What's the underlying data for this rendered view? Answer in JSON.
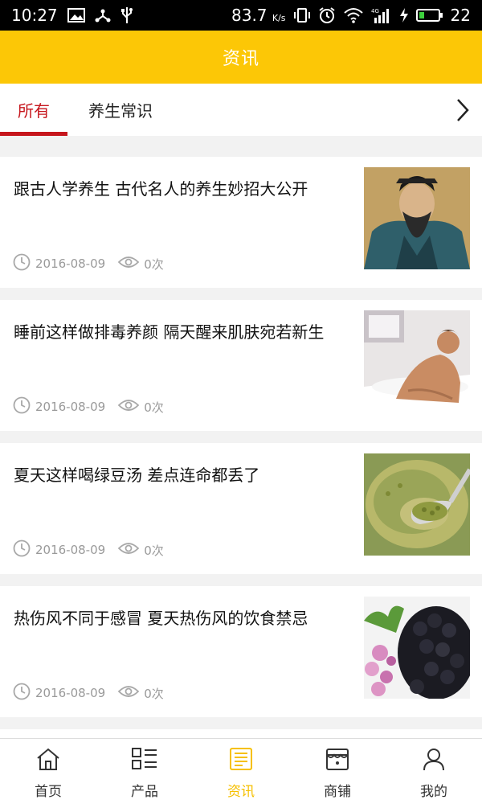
{
  "status_bar": {
    "time": "10:27",
    "speed": "83.7",
    "speed_unit": "K/s",
    "battery": "22",
    "network": "4G"
  },
  "header": {
    "title": "资讯"
  },
  "tabs": [
    {
      "label": "所有",
      "active": true
    },
    {
      "label": "养生常识",
      "active": false
    }
  ],
  "articles": [
    {
      "title": "跟古人学养生 古代名人的养生妙招大公开",
      "date": "2016-08-09",
      "views": "0次",
      "image": "ancient-portrait"
    },
    {
      "title": "睡前这样做排毒养颜 隔天醒来肌肤宛若新生",
      "date": "2016-08-09",
      "views": "0次",
      "image": "bathtub-man"
    },
    {
      "title": "夏天这样喝绿豆汤 差点连命都丢了",
      "date": "2016-08-09",
      "views": "0次",
      "image": "mung-bean-soup"
    },
    {
      "title": "热伤风不同于感冒 夏天热伤风的饮食禁忌",
      "date": "2016-08-09",
      "views": "0次",
      "image": "dried-plums"
    }
  ],
  "bottom_nav": [
    {
      "label": "首页",
      "icon": "home-icon"
    },
    {
      "label": "产品",
      "icon": "product-grid-icon"
    },
    {
      "label": "资讯",
      "icon": "news-icon",
      "active": true
    },
    {
      "label": "商铺",
      "icon": "shop-icon"
    },
    {
      "label": "我的",
      "icon": "user-icon"
    }
  ],
  "colors": {
    "header_bg": "#fcc706",
    "tab_active": "#c6161d",
    "nav_active": "#f6c000",
    "meta_text": "#9a9a9a"
  }
}
